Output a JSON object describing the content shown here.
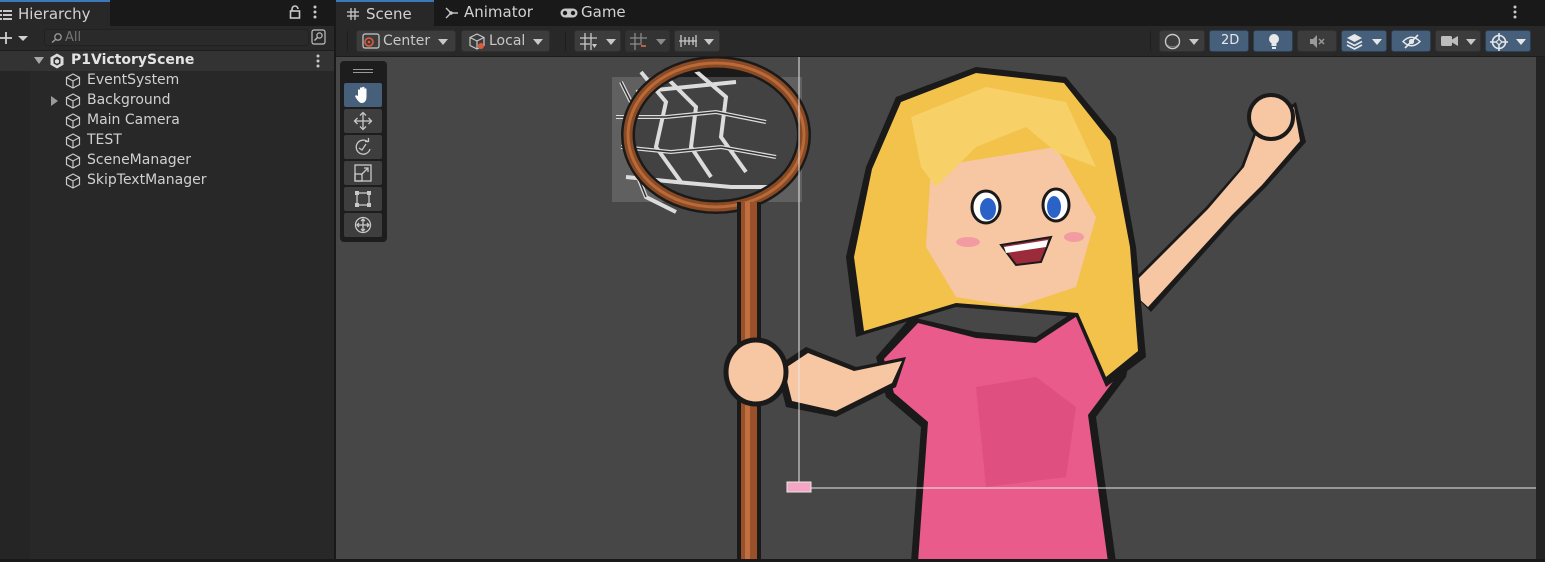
{
  "hierarchy": {
    "tab_label": "Hierarchy",
    "tab_icon": "list-icon",
    "search_placeholder": "All",
    "scene_name": "P1VictoryScene",
    "items": [
      {
        "label": "EventSystem",
        "icon": "cube-icon",
        "expandable": false
      },
      {
        "label": "Background",
        "icon": "cube-icon",
        "expandable": true
      },
      {
        "label": "Main Camera",
        "icon": "cube-icon",
        "expandable": false
      },
      {
        "label": "TEST",
        "icon": "cube-icon",
        "expandable": false
      },
      {
        "label": "SceneManager",
        "icon": "cube-icon",
        "expandable": false
      },
      {
        "label": "SkipTextManager",
        "icon": "cube-icon",
        "expandable": false
      }
    ]
  },
  "scene_tabs": [
    {
      "label": "Scene",
      "icon": "grid-icon",
      "active": true
    },
    {
      "label": "Animator",
      "icon": "animator-icon",
      "active": false
    },
    {
      "label": "Game",
      "icon": "gamepad-icon",
      "active": false
    }
  ],
  "toolbar": {
    "pivot_label": "Center",
    "space_label": "Local",
    "mode_2d_label": "2D"
  },
  "tools": [
    "hand-tool",
    "move-tool",
    "rotate-tool",
    "scale-tool",
    "rect-tool",
    "transform-tool"
  ],
  "colors": {
    "accent": "#3a79bb",
    "active_button": "#46607c",
    "viewport_bg": "#474747",
    "panel_bg": "#282828"
  }
}
